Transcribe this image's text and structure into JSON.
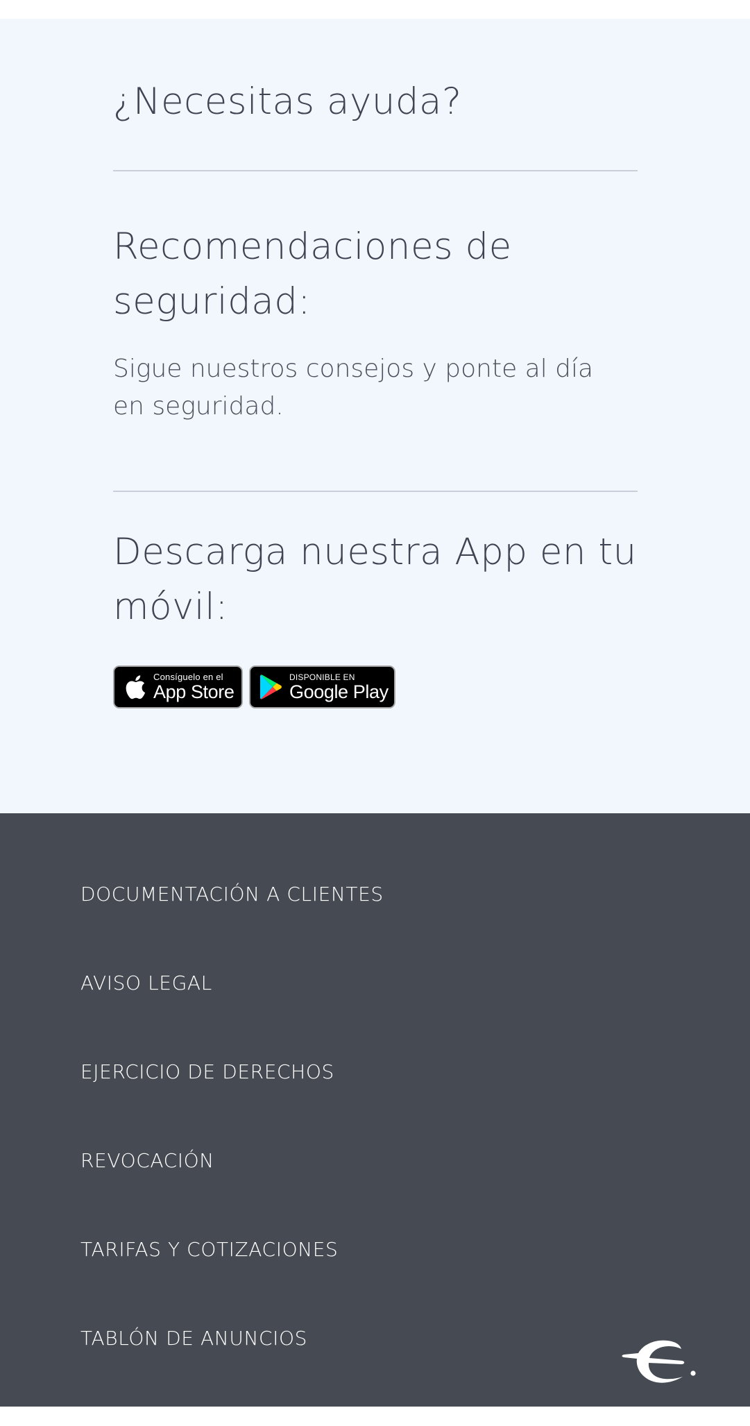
{
  "help": {
    "title": "¿Necesitas ayuda?",
    "security": {
      "title_line1": "Recomendaciones de",
      "title_line2": "seguridad:",
      "text_line1": "Sigue nuestros consejos y ponte al día",
      "text_line2": "en seguridad."
    },
    "app": {
      "title_line1": "Descarga nuestra App en tu",
      "title_line2": "móvil:",
      "app_store": {
        "small": "Consíguelo en el",
        "big": "App Store",
        "icon": "apple-icon"
      },
      "google_play": {
        "small": "DISPONIBLE EN",
        "big": "Google Play",
        "icon": "google-play-icon"
      }
    }
  },
  "footer": {
    "links": [
      "DOCUMENTACIÓN A CLIENTES",
      "AVISO LEGAL",
      "EJERCICIO DE DERECHOS",
      "REVOCACIÓN",
      "TARIFAS Y COTIZACIONES",
      "TABLÓN DE ANUNCIOS"
    ],
    "logo": "brand-logo-icon"
  },
  "colors": {
    "help_bg": "#f2f6fd",
    "footer_bg": "#464b53",
    "heading_text": "#3e4451",
    "divider": "#c9ced9"
  }
}
